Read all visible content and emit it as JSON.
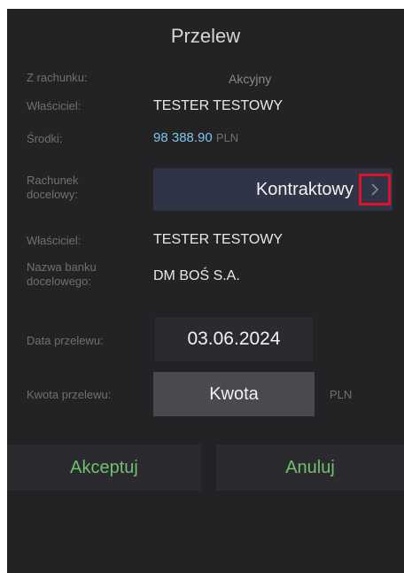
{
  "header": {
    "title": "Przelew"
  },
  "from_account": {
    "label": "Z rachunku:",
    "value": "Akcyjny"
  },
  "owner": {
    "label": "Właściciel:",
    "value": "TESTER TESTOWY"
  },
  "funds": {
    "label": "Środki:",
    "amount": "98 388.90",
    "currency": "PLN"
  },
  "target_account": {
    "label_line1": "Rachunek",
    "label_line2": "docelowy:",
    "value": "Kontraktowy",
    "icon": "chevron-right-icon"
  },
  "target_owner": {
    "label": "Właściciel:",
    "value": "TESTER TESTOWY"
  },
  "target_bank": {
    "label_line1": "Nazwa banku",
    "label_line2": "docelowego:",
    "value": "DM BOŚ S.A."
  },
  "transfer_date": {
    "label": "Data przelewu:",
    "value": "03.06.2024"
  },
  "transfer_amount": {
    "label": "Kwota przelewu:",
    "placeholder": "Kwota",
    "currency": "PLN"
  },
  "actions": {
    "accept_label": "Akceptuj",
    "cancel_label": "Anuluj"
  },
  "colors": {
    "background": "#232326",
    "accent_blue": "#7fc5e8",
    "accent_green": "#6fc06f",
    "highlight_red": "#e0102a"
  }
}
